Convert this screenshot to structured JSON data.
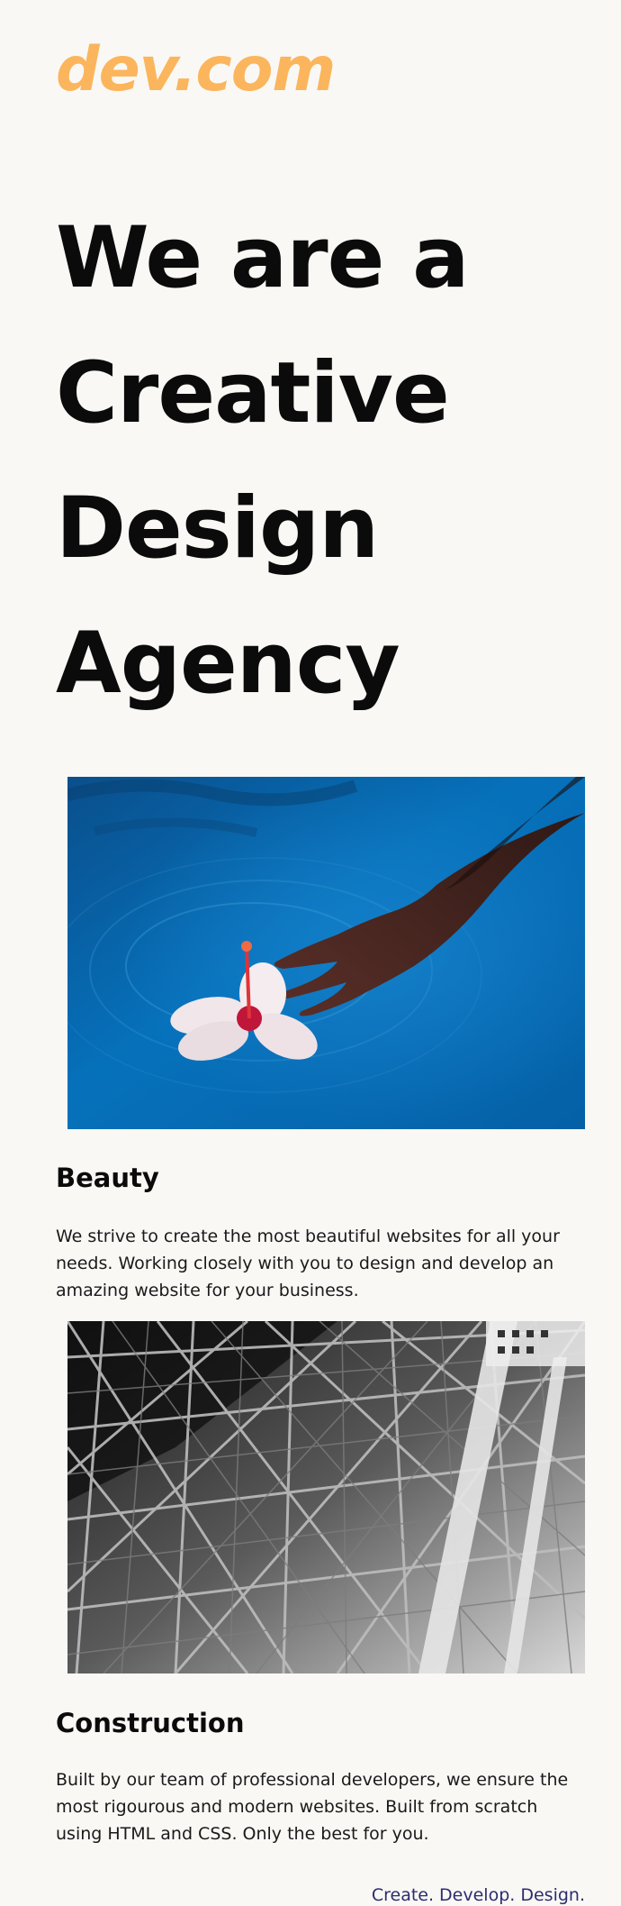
{
  "header": {
    "logo": "dev.com"
  },
  "hero": {
    "line1": "We are a",
    "line2": "Creative",
    "line3": "Design",
    "line4": "Agency"
  },
  "cards": [
    {
      "image": "hand-flower-water-photo",
      "title": "Beauty",
      "text": "We strive to create the most beautiful websites for all your needs. Working closely with you to design and develop an amazing website for your business."
    },
    {
      "image": "steel-structure-photo",
      "title": "Construction",
      "text": "Built by our team of professional developers, we ensure the most rigourous and modern websites. Built from scratch using HTML and CSS. Only the best for you."
    }
  ],
  "footer": {
    "tagline": "Create. Develop. Design."
  },
  "colors": {
    "background": "#f9f8f5",
    "logo": "#fbb55c",
    "tagline": "#2b2d6e",
    "water": "#0568ad"
  }
}
